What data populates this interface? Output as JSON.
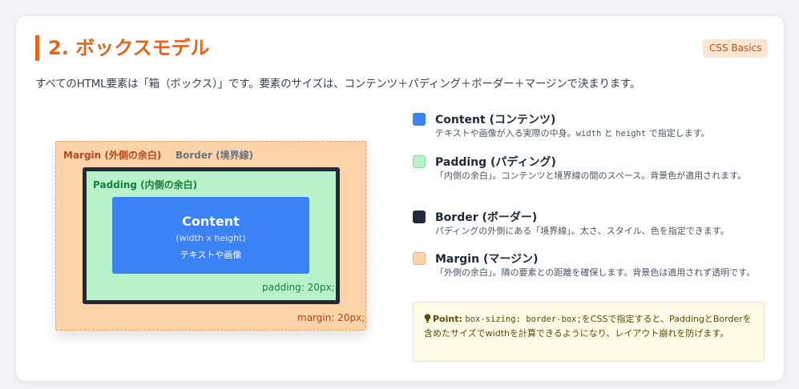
{
  "header": {
    "title": "2. ボックスモデル",
    "badge": "CSS Basics"
  },
  "intro": "すべてのHTML要素は「箱（ボックス）」です。要素のサイズは、コンテンツ＋パディング＋ボーダー＋マージンで決まります。",
  "diagram": {
    "margin_label": "Margin (外側の余白)",
    "border_label": "Border (境界線)",
    "padding_label": "Padding (内側の余白)",
    "content_title": "Content",
    "content_sub": "(width x height)",
    "content_text": "テキストや画像",
    "padding_code": "padding: 20px;",
    "margin_code": "margin: 20px;"
  },
  "legend": [
    {
      "title": "Content (コンテンツ)",
      "desc_before": "テキストや画像が入る実際の中身。",
      "code1": "width",
      "desc_mid": " と ",
      "code2": "height",
      "desc_after": " で指定します。",
      "color": "#3b82f6"
    },
    {
      "title": "Padding (パディング)",
      "desc": "「内側の余白」。コンテンツと境界線の間のスペース。背景色が適用されます。",
      "color": "#b8f2cb"
    },
    {
      "title": "Border (ボーダー)",
      "desc": "パディングの外側にある「境界線」。太さ、スタイル、色を指定できます。",
      "color": "#1f2a3b"
    },
    {
      "title": "Margin (マージン)",
      "desc": "「外側の余白」。隣の要素との距離を確保します。背景色は適用されず透明です。",
      "color": "#fdd3a9"
    }
  ],
  "point": {
    "icon": "lightbulb-icon",
    "label": "Point:",
    "code": "box-sizing: border-box;",
    "text": "をCSSで指定すると、PaddingとBorderを含めたサイズでwidthを計算できるようになり、レイアウト崩れを防げます。"
  },
  "colors": {
    "accent": "#e4641b",
    "content": "#3b82f6",
    "padding": "#b8f2cb",
    "border": "#1f2a3b",
    "margin": "#fdd3a9"
  }
}
